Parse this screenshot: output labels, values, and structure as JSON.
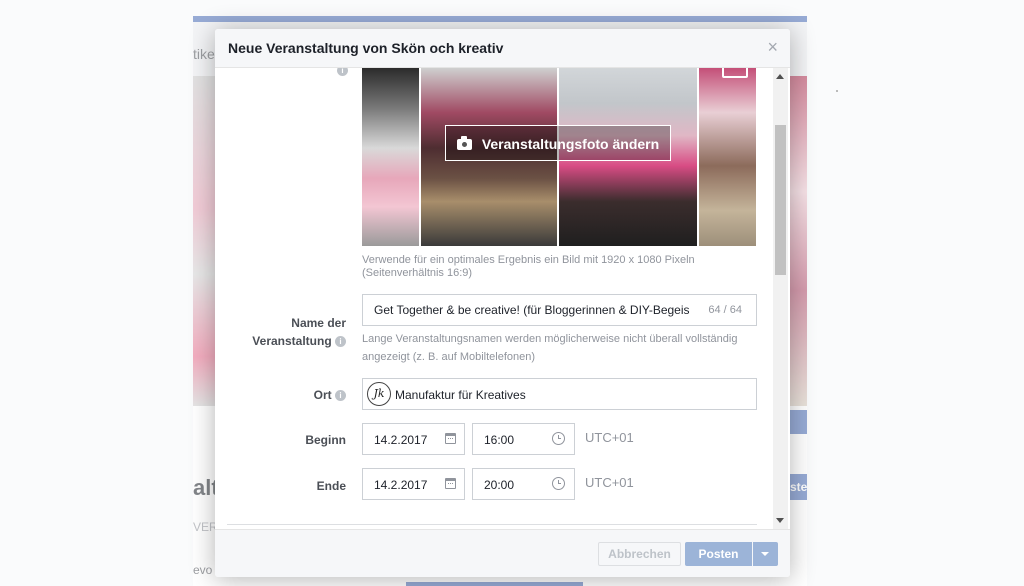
{
  "background": {
    "partial_text_1": "tike",
    "partial_text_2": "alt",
    "partial_text_3": "VER",
    "partial_text_4": "evo",
    "partial_button": "ste"
  },
  "modal": {
    "title": "Neue Veranstaltung von Skön och kreativ",
    "close_symbol": "×",
    "info_symbol": "i",
    "photo": {
      "change_label": "Veranstaltungsfoto ändern",
      "hint": "Verwende für ein optimales Ergebnis ein Bild mit 1920 x 1080 Pixeln (Seitenverhältnis 16:9)"
    },
    "name": {
      "label_line1": "Name der",
      "label_line2": "Veranstaltung",
      "value": "Get Together & be creative! (für Bloggerinnen & DIY-Begeis",
      "count": "64 / 64",
      "hint": "Lange Veranstaltungsnamen werden möglicherweise nicht überall vollständig angezeigt (z. B. auf Mobiltelefonen)"
    },
    "location": {
      "label": "Ort",
      "avatar_text": "Jk",
      "value": "Manufaktur für Kreatives"
    },
    "start": {
      "label": "Beginn",
      "date": "14.2.2017",
      "time": "16:00",
      "timezone": "UTC+01"
    },
    "end": {
      "label": "Ende",
      "date": "14.2.2017",
      "time": "20:00",
      "timezone": "UTC+01"
    },
    "footer": {
      "cancel_label": "Abbrechen",
      "post_label": "Posten"
    }
  },
  "colors": {
    "brand_blue": "#4267b2",
    "disabled_blue": "#9cb4d8",
    "label_gray": "#4b4f56",
    "hint_gray": "#90949c"
  },
  "icons": [
    "close-icon",
    "info-icon",
    "camera-icon",
    "calendar-icon",
    "clock-icon",
    "chevron-down-icon"
  ]
}
